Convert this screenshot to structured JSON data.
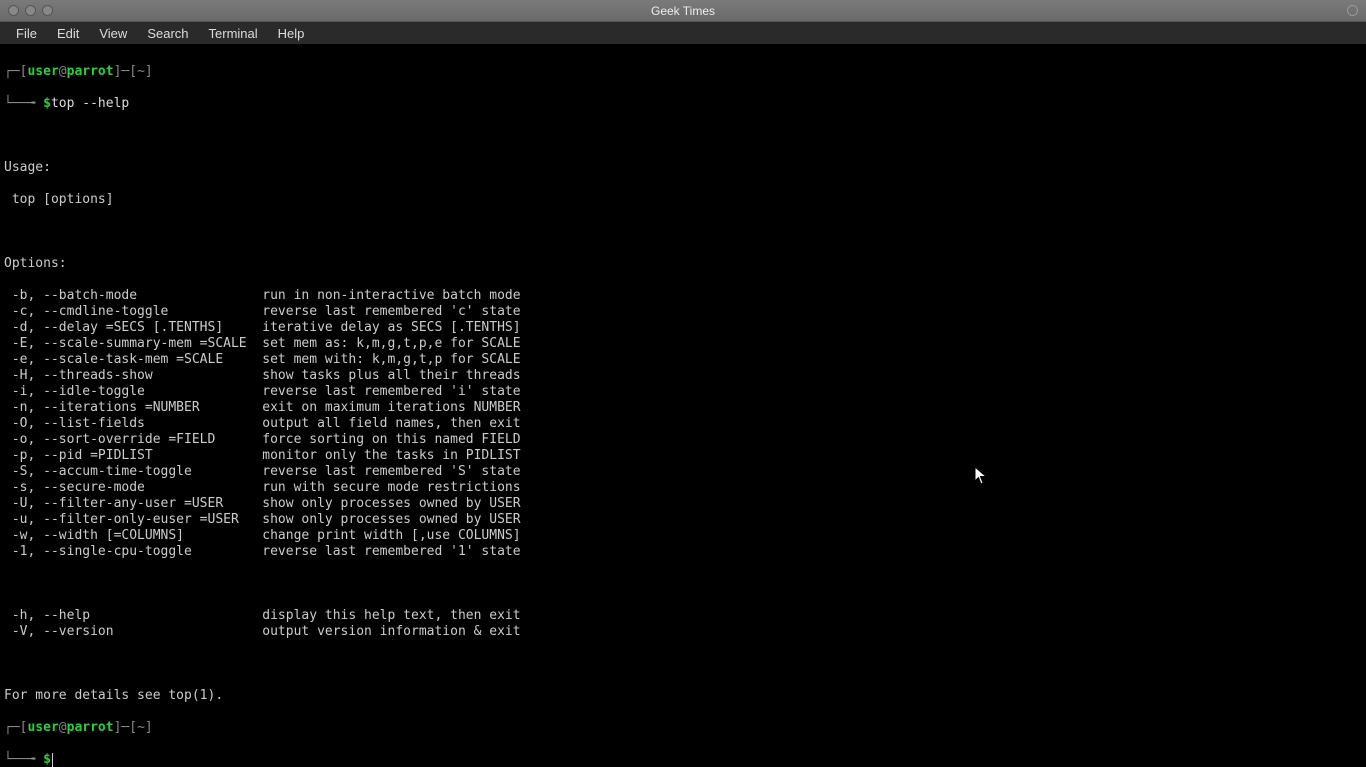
{
  "window": {
    "title": "Geek Times"
  },
  "menu": {
    "file": "File",
    "edit": "Edit",
    "view": "View",
    "search": "Search",
    "terminal": "Terminal",
    "help": "Help"
  },
  "prompt": {
    "user": "user",
    "at": "@",
    "host": "parrot",
    "path": "~",
    "dollar": "$",
    "cmd1": "top --help"
  },
  "usage": {
    "hdr": "Usage:",
    "line": " top [options]"
  },
  "options_hdr": "Options:",
  "opts": [
    {
      "f": " -b, --batch-mode",
      "d": "run in non-interactive batch mode"
    },
    {
      "f": " -c, --cmdline-toggle",
      "d": "reverse last remembered 'c' state"
    },
    {
      "f": " -d, --delay =SECS [.TENTHS]",
      "d": "iterative delay as SECS [.TENTHS]"
    },
    {
      "f": " -E, --scale-summary-mem =SCALE",
      "d": "set mem as: k,m,g,t,p,e for SCALE"
    },
    {
      "f": " -e, --scale-task-mem =SCALE",
      "d": "set mem with: k,m,g,t,p for SCALE"
    },
    {
      "f": " -H, --threads-show",
      "d": "show tasks plus all their threads"
    },
    {
      "f": " -i, --idle-toggle",
      "d": "reverse last remembered 'i' state"
    },
    {
      "f": " -n, --iterations =NUMBER",
      "d": "exit on maximum iterations NUMBER"
    },
    {
      "f": " -O, --list-fields",
      "d": "output all field names, then exit"
    },
    {
      "f": " -o, --sort-override =FIELD",
      "d": "force sorting on this named FIELD"
    },
    {
      "f": " -p, --pid =PIDLIST",
      "d": "monitor only the tasks in PIDLIST"
    },
    {
      "f": " -S, --accum-time-toggle",
      "d": "reverse last remembered 'S' state"
    },
    {
      "f": " -s, --secure-mode",
      "d": "run with secure mode restrictions"
    },
    {
      "f": " -U, --filter-any-user =USER",
      "d": "show only processes owned by USER"
    },
    {
      "f": " -u, --filter-only-euser =USER",
      "d": "show only processes owned by USER"
    },
    {
      "f": " -w, --width [=COLUMNS]",
      "d": "change print width [,use COLUMNS]"
    },
    {
      "f": " -1, --single-cpu-toggle",
      "d": "reverse last remembered '1' state"
    }
  ],
  "opts2": [
    {
      "f": " -h, --help",
      "d": "display this help text, then exit"
    },
    {
      "f": " -V, --version",
      "d": "output version information & exit"
    }
  ],
  "footer": "For more details see top(1)."
}
